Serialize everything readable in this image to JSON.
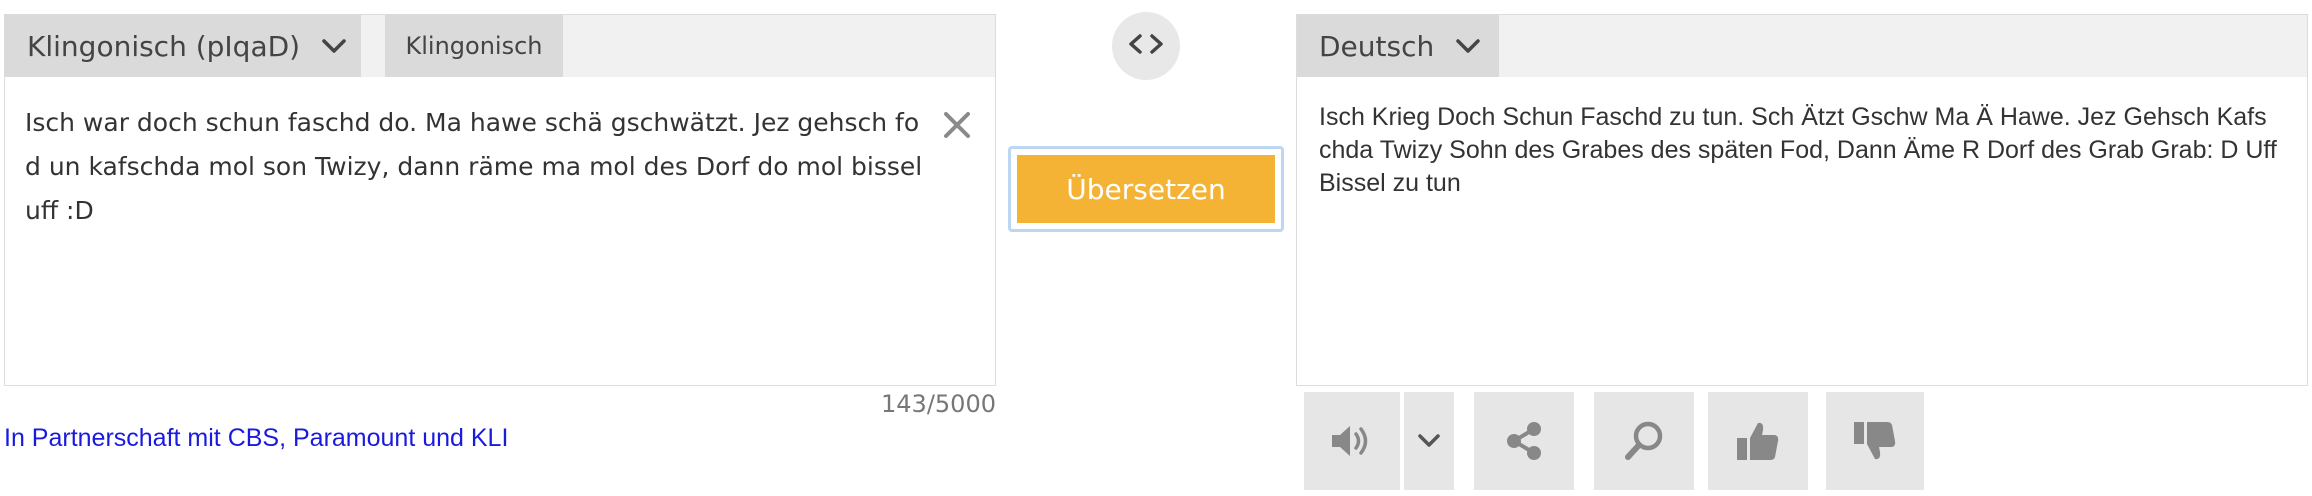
{
  "source": {
    "language_label": "Klingonisch (pIqaD)",
    "detected_tab_label": "Klingonisch",
    "text": "Isch war doch schun faschd do. Ma hawe schä gschwätzt. Jez gehsch fod un kafschda mol son Twizy, dann räme ma mol des Dorf do mol bissel uff :D",
    "char_count": "143/5000"
  },
  "partner_link": "In Partnerschaft mit CBS, Paramount und KLI",
  "translate_button_label": "Übersetzen",
  "target": {
    "language_label": "Deutsch",
    "text": "Isch Krieg Doch Schun Faschd zu tun. Sch Ätzt Gschw Ma Ä Hawe. Jez Gehsch Kafschda Twizy Sohn des Grabes des späten Fod, Dann Äme R Dorf des Grab Grab: D Uff Bissel zu tun"
  },
  "toolbar": {
    "icons": [
      "speaker-icon",
      "chevron-down-icon",
      "share-icon",
      "search-icon",
      "thumbs-up-icon",
      "thumbs-down-icon"
    ]
  },
  "colors": {
    "accent_button": "#f4b335",
    "link": "#1a1adf",
    "focus_ring": "#bcd6f3"
  }
}
